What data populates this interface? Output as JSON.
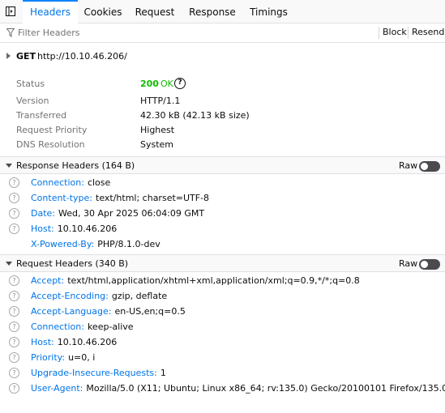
{
  "tabs": [
    {
      "label": "Headers",
      "active": true
    },
    {
      "label": "Cookies",
      "active": false
    },
    {
      "label": "Request",
      "active": false
    },
    {
      "label": "Response",
      "active": false
    },
    {
      "label": "Timings",
      "active": false
    }
  ],
  "filter": {
    "placeholder": "Filter Headers",
    "block_label": "Block",
    "resend_label": "Resend"
  },
  "request": {
    "method": "GET",
    "url": "http://10.10.46.206/"
  },
  "summary": {
    "status": {
      "label": "Status",
      "code": "200",
      "text": "OK"
    },
    "version": {
      "label": "Version",
      "value": "HTTP/1.1"
    },
    "transferred": {
      "label": "Transferred",
      "value": "42.30 kB (42.13 kB size)"
    },
    "priority": {
      "label": "Request Priority",
      "value": "Highest"
    },
    "dns": {
      "label": "DNS Resolution",
      "value": "System"
    }
  },
  "response_headers": {
    "title": "Response Headers (164 B)",
    "raw_label": "Raw",
    "raw_enabled": false,
    "items": [
      {
        "name": "Connection:",
        "value": "close",
        "help": true
      },
      {
        "name": "Content-type:",
        "value": "text/html; charset=UTF-8",
        "help": true
      },
      {
        "name": "Date:",
        "value": "Wed, 30 Apr 2025 06:04:09 GMT",
        "help": true
      },
      {
        "name": "Host:",
        "value": "10.10.46.206",
        "help": true
      },
      {
        "name": "X-Powered-By:",
        "value": "PHP/8.1.0-dev",
        "help": false
      }
    ]
  },
  "request_headers": {
    "title": "Request Headers (340 B)",
    "raw_label": "Raw",
    "raw_enabled": false,
    "items": [
      {
        "name": "Accept:",
        "value": "text/html,application/xhtml+xml,application/xml;q=0.9,*/*;q=0.8",
        "help": true
      },
      {
        "name": "Accept-Encoding:",
        "value": "gzip, deflate",
        "help": true
      },
      {
        "name": "Accept-Language:",
        "value": "en-US,en;q=0.5",
        "help": true
      },
      {
        "name": "Connection:",
        "value": "keep-alive",
        "help": true
      },
      {
        "name": "Host:",
        "value": "10.10.46.206",
        "help": true
      },
      {
        "name": "Priority:",
        "value": "u=0, i",
        "help": true
      },
      {
        "name": "Upgrade-Insecure-Requests:",
        "value": "1",
        "help": true
      },
      {
        "name": "User-Agent:",
        "value": "Mozilla/5.0 (X11; Ubuntu; Linux x86_64; rv:135.0) Gecko/20100101 Firefox/135.0",
        "help": true
      }
    ]
  },
  "help_glyph": "?",
  "icons": {
    "panel_toggle": "sidebar-toggle-icon",
    "filter": "filter-icon",
    "help": "question-mark-icon",
    "expand": "twisty-icon"
  },
  "colors": {
    "accent": "#0074e8",
    "status_ok": "#12bc00",
    "header_name": "#0074e8"
  }
}
